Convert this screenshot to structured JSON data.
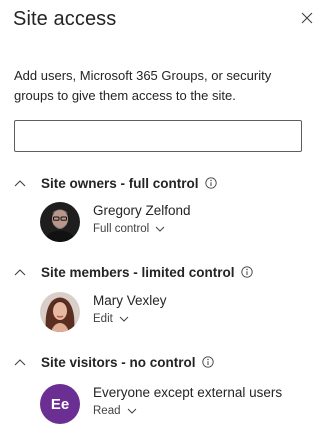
{
  "panel": {
    "title": "Site access",
    "close_icon": "close-icon",
    "description": "Add users, Microsoft 365 Groups, or security groups to give them access to the site.",
    "search": {
      "value": "",
      "placeholder": ""
    }
  },
  "groups": [
    {
      "title": "Site owners - full control",
      "members": [
        {
          "name": "Gregory Zelfond",
          "permission": "Full control",
          "avatar": "photo"
        }
      ]
    },
    {
      "title": "Site members - limited control",
      "members": [
        {
          "name": "Mary Vexley",
          "permission": "Edit",
          "avatar": "photo"
        }
      ]
    },
    {
      "title": "Site visitors - no control",
      "members": [
        {
          "name": "Everyone except external users",
          "permission": "Read",
          "avatar": "initials",
          "initials": "Ee",
          "avatar_color": "#6b2e93"
        }
      ]
    }
  ],
  "colors": {
    "text": "#242424",
    "border": "#605e5c",
    "accent_avatar": "#6b2e93"
  }
}
